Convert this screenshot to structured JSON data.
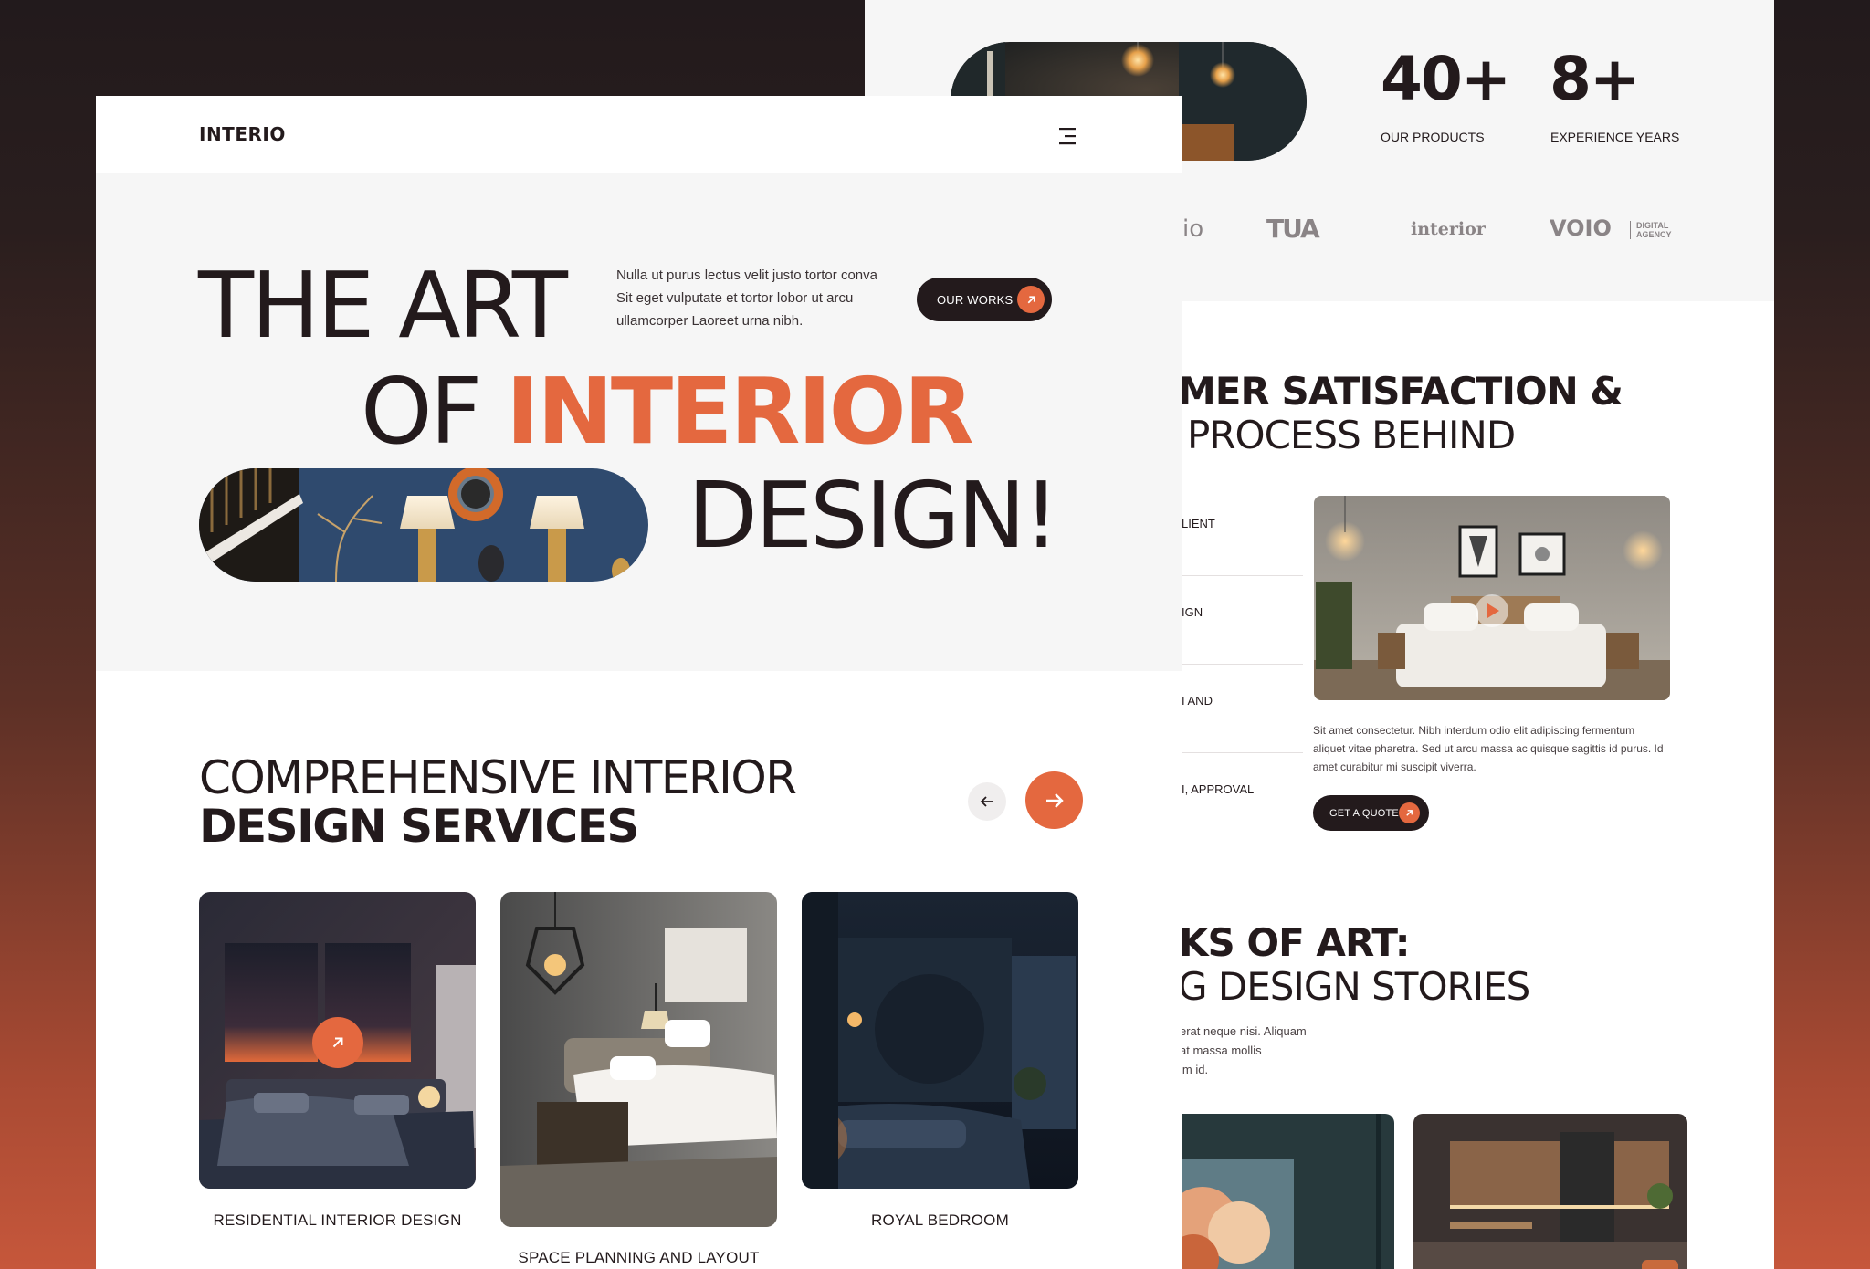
{
  "back": {
    "stats": [
      {
        "number": "40+",
        "label": "OUR PRODUCTS"
      },
      {
        "number": "8+",
        "label": "EXPERIENCE YEARS"
      }
    ],
    "brands": [
      "io",
      "TUA",
      "interior",
      "VOIO",
      "DIGITAL AGENCY"
    ],
    "satisfaction_heading_line1": "MER SATISFACTION &",
    "satisfaction_heading_line2": "PROCESS BEHIND",
    "process_items": [
      "LIENT",
      "IGN",
      "I AND",
      "I, APPROVAL"
    ],
    "process_text": "Sit amet consectetur. Nibh interdum odio elit adipiscing fermentum aliquet vitae pharetra. Sed ut arcu massa ac quisque sagittis id purus. Id amet curabitur mi suscipit viverra.",
    "quote_button": "GET A QUOTE",
    "works_heading_line1": "KS OF ART:",
    "works_heading_line2": "G DESIGN STORIES",
    "works_text_lines": [
      "erat neque nisi. Aliquam",
      "at massa mollis",
      "im id."
    ]
  },
  "front": {
    "logo": "INTERIO",
    "hero": {
      "line1": "THE ART",
      "line2_a": "OF ",
      "line2_b": "INTERIOR",
      "line3": "DESIGN!",
      "blurb_lines": [
        "Nulla ut purus lectus velit justo tortor conva",
        "Sit eget vulputate et tortor lobor ut arcu",
        "ullamcorper Laoreet urna nibh."
      ],
      "cta": "OUR WORKS"
    },
    "services": {
      "title_line1": "COMPREHENSIVE INTERIOR",
      "title_line2": "DESIGN SERVICES",
      "cards": [
        {
          "caption": "RESIDENTIAL INTERIOR DESIGN"
        },
        {
          "caption": "SPACE PLANNING AND LAYOUT"
        },
        {
          "caption": "ROYAL BEDROOM"
        }
      ]
    }
  },
  "colors": {
    "accent": "#e4683f",
    "dark": "#231a1c",
    "page": "#f6f6f6"
  },
  "icons": [
    "menu-icon",
    "arrow-up-right-icon",
    "arrow-left-icon",
    "arrow-right-icon",
    "play-icon"
  ]
}
